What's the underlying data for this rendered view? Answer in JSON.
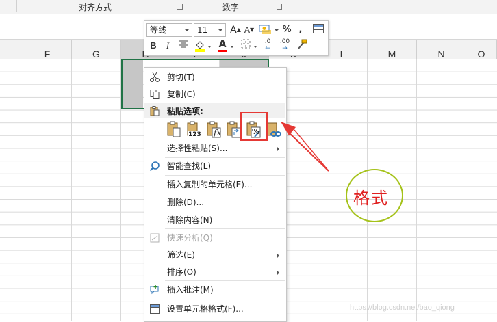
{
  "ribbon": {
    "groups": [
      {
        "label": "对齐方式"
      },
      {
        "label": "数字"
      }
    ]
  },
  "columns": [
    "F",
    "G",
    "H",
    "I",
    "J",
    "K",
    "L",
    "M",
    "N",
    "O"
  ],
  "selected_columns": [
    "H",
    "I",
    "J"
  ],
  "mini_toolbar": {
    "font_name": "等线",
    "font_size": "11",
    "buttons": {
      "grow_font": "A",
      "shrink_font": "A",
      "percent": "%",
      "comma": ",",
      "bold": "B",
      "italic": "I",
      "font_color_letter": "A",
      "increase_decimal": ".00",
      "decrease_decimal": ".0"
    },
    "colors": {
      "fill": "#ffff00",
      "font": "#ff0000"
    }
  },
  "context_menu": {
    "items": [
      {
        "label": "剪切(T)",
        "icon": "scissors-icon"
      },
      {
        "label": "复制(C)",
        "icon": "copy-icon"
      },
      {
        "label": "粘贴选项:",
        "icon": "clipboard-icon"
      },
      {
        "label": "选择性粘贴(S)...",
        "submenu": true
      },
      {
        "label": "智能查找(L)",
        "icon": "search-icon"
      },
      {
        "label": "插入复制的单元格(E)..."
      },
      {
        "label": "删除(D)..."
      },
      {
        "label": "清除内容(N)"
      },
      {
        "label": "快速分析(Q)",
        "icon": "quick-analysis-icon",
        "disabled": true
      },
      {
        "label": "筛选(E)",
        "submenu": true
      },
      {
        "label": "排序(O)",
        "submenu": true
      },
      {
        "label": "插入批注(M)",
        "icon": "comment-icon"
      },
      {
        "label": "设置单元格格式(F)...",
        "icon": "format-cells-icon"
      }
    ],
    "paste_options": [
      {
        "name": "paste-icon"
      },
      {
        "name": "paste-values-icon",
        "text": "123"
      },
      {
        "name": "paste-formulas-icon",
        "text": "fx"
      },
      {
        "name": "paste-transpose-icon"
      },
      {
        "name": "paste-formatting-icon",
        "text": "%"
      },
      {
        "name": "paste-link-icon"
      }
    ]
  },
  "annotation": {
    "label": "格式",
    "colors": {
      "box": "#e53935",
      "arrow": "#e53935",
      "ellipse": "#a5c21a",
      "text": "#e02020"
    }
  },
  "watermark": "https://blog.csdn.net/bao_qiong"
}
